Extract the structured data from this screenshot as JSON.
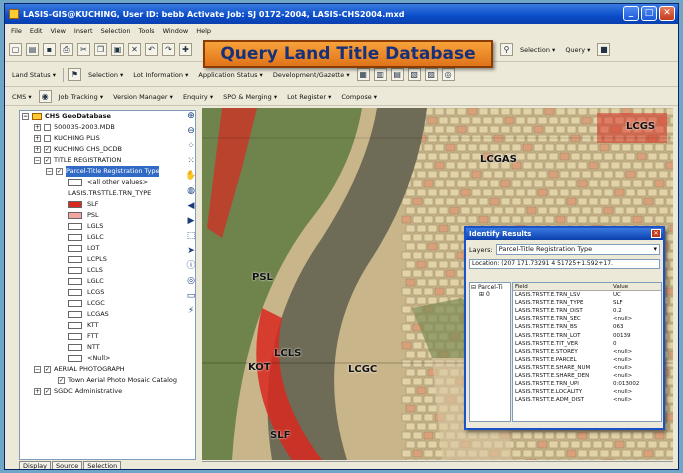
{
  "title": "LASIS-GIS@KUCHING, User ID: bebb   Activate Job: SJ 0172-2004,   LASIS-CHS2004.mxd",
  "menu": [
    "File",
    "Edit",
    "View",
    "Insert",
    "Selection",
    "Tools",
    "Window",
    "Help"
  ],
  "banner": "Query Land Title Database",
  "toolbar1": {
    "selection_label": "Selection",
    "query_label": "Query"
  },
  "toolbar2": [
    "Land Status",
    "Selection",
    "Lot Information",
    "Application Status",
    "Development/Gazette"
  ],
  "toolbar3": [
    "CMS",
    "Job Tracking",
    "Version Manager",
    "Enquiry",
    "SPO & Merging",
    "Lot Register",
    "Compose"
  ],
  "toc": {
    "root": "CHS GeoDatabase",
    "layers": [
      "500035-2003.MDB",
      "KUCHING PLIS",
      "KUCHING CHS_DCDB",
      "TITLE REGISTRATION"
    ],
    "selected_layer": "Parcel-Title Registration Type",
    "values_header": "<all other values>",
    "field_name": "LASIS.TRSTTLE.TRN_TYPE",
    "legend": [
      {
        "label": "SLF",
        "color": "#d9281e"
      },
      {
        "label": "PSL",
        "color": "#f2a6a0"
      },
      {
        "label": "LGLS",
        "color": "#ffffff"
      },
      {
        "label": "LGLC",
        "color": "#ffffff"
      },
      {
        "label": "LOT",
        "color": "#ffffff"
      },
      {
        "label": "LCPLS",
        "color": "#ffffff"
      },
      {
        "label": "LCLS",
        "color": "#ffffff"
      },
      {
        "label": "LGLC",
        "color": "#ffffff"
      },
      {
        "label": "LCGS",
        "color": "#ffffff"
      },
      {
        "label": "LCGC",
        "color": "#ffffff"
      },
      {
        "label": "LCGAS",
        "color": "#ffffff"
      },
      {
        "label": "KTT",
        "color": "#ffffff"
      },
      {
        "label": "FTT",
        "color": "#ffffff"
      },
      {
        "label": "NTT",
        "color": "#ffffff"
      },
      {
        "label": "<Null>",
        "color": "#ffffff"
      }
    ],
    "aerial": "AERIAL PHOTOGRAPH",
    "aerial_sub": "Town Aerial Photo Mosaic Catalog",
    "sgdc": "SGDC Administrative",
    "tabs": [
      "Display",
      "Source",
      "Selection"
    ]
  },
  "map": {
    "labels": [
      "LCGS",
      "LCGAS",
      "PSL",
      "LCLS",
      "KOT",
      "LCGC",
      "SLF"
    ],
    "colors": {
      "river": "#6e6b56",
      "parcel": "#d8c7a0",
      "slf": "#d9281e",
      "vegetation": "#5f7a42"
    }
  },
  "identify": {
    "title": "Identify Results",
    "layers_label": "Layers:",
    "layer_value": "Parcel-Title Registration Type",
    "tree_root": "Parcel-Ti",
    "tree_child": "0",
    "location": "Location: (207 171.73291 4 51725+1.592+17.",
    "columns": [
      "Field",
      "Value"
    ],
    "rows": [
      [
        "LASIS.TRSTT.E.TRN_LSV",
        "UC"
      ],
      [
        "LASIS.TRSTT.E.TRN_TYPE",
        "SLF"
      ],
      [
        "LASIS.TRSTT.E.TRN_DIST",
        "0.2"
      ],
      [
        "LASIS.TRSTT.E.TRN_SEC",
        "<null>"
      ],
      [
        "LASIS.TRSTT.E.TRN_BS",
        "063"
      ],
      [
        "LASIS.TRSTT.E.TRN_LOT",
        "00139"
      ],
      [
        "LASIS.TRSTT.E.TIT_VER",
        "0"
      ],
      [
        "LASIS.TRSTT.E.STOREY",
        "<null>"
      ],
      [
        "LASIS.TRSTT.E.PARCEL",
        "<null>"
      ],
      [
        "LASIS.TRSTT.E.SHARE_NUM",
        "<null>"
      ],
      [
        "LASIS.TRSTT.E.SHARE_DEN",
        "<null>"
      ],
      [
        "LASIS.TRSTT.E.TRN_UPI",
        "0:013002"
      ],
      [
        "LASIS.TRSTT.E.LOCALITY",
        "<null>"
      ],
      [
        "LASIS.TRSTT.E.ADM_DIST",
        "<null>"
      ]
    ]
  },
  "status": ""
}
